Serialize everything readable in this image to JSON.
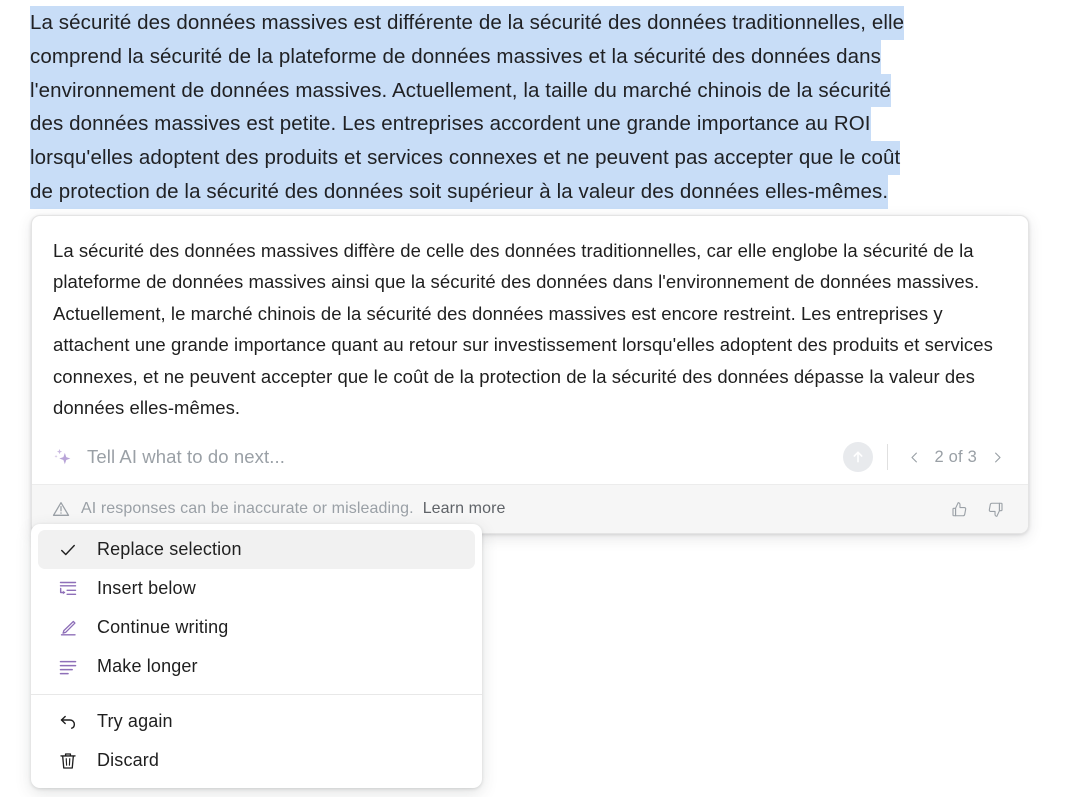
{
  "selection": {
    "name": "highlighted-source-paragraph",
    "highlight_color": "#c8ddf7",
    "lines": [
      "La sécurité des données massives est différente de la sécurité des données traditionnelles, elle",
      "comprend la sécurité de la plateforme de données massives et la sécurité des données dans",
      "l'environnement de données massives. Actuellement, la taille du marché chinois de la sécurité",
      "des données massives est petite. Les entreprises accordent une grande importance au ROI",
      "lorsqu'elles adoptent des produits et services connexes et ne peuvent pas accepter que le coût",
      "de protection de la sécurité des données soit supérieur à la valeur des données elles-mêmes."
    ]
  },
  "ai_card": {
    "response_text": "La sécurité des données massives diffère de celle des données traditionnelles, car elle englobe la sécurité de la plateforme de données massives ainsi que la sécurité des données dans l'environnement de données massives. Actuellement, le marché chinois de la sécurité des données massives est encore restreint. Les entreprises y attachent une grande importance quant au retour sur investissement lorsqu'elles adoptent des produits et services connexes, et ne peuvent accepter que le coût de la protection de la sécurité des données dépasse la valeur des données elles-mêmes.",
    "prompt": {
      "icon": "sparkle-icon",
      "value": "",
      "placeholder": "Tell AI what to do next...",
      "accent_color": "#b9a5d8"
    },
    "submit": {
      "icon": "arrow-up-icon",
      "label": "Submit"
    },
    "pager": {
      "prev_icon": "chevron-left-icon",
      "next_icon": "chevron-right-icon",
      "label": "2 of 3",
      "current": 2,
      "total": 3
    },
    "disclaimer": {
      "icon": "warning-triangle-icon",
      "text": "AI responses can be inaccurate or misleading.",
      "learn_more": "Learn more"
    },
    "feedback": {
      "thumbs_up_icon": "thumbs-up-icon",
      "thumbs_down_icon": "thumbs-down-icon"
    }
  },
  "menu": {
    "items": [
      {
        "label": "Replace selection",
        "icon": "check-icon",
        "selected": true,
        "icon_color": "#1f1f1f"
      },
      {
        "label": "Insert below",
        "icon": "insert-below-icon",
        "selected": false,
        "icon_color": "#8e6fb8"
      },
      {
        "label": "Continue writing",
        "icon": "pencil-icon",
        "selected": false,
        "icon_color": "#8e6fb8"
      },
      {
        "label": "Make longer",
        "icon": "text-lines-icon",
        "selected": false,
        "icon_color": "#8e6fb8"
      }
    ],
    "items_secondary": [
      {
        "label": "Try again",
        "icon": "undo-arrow-icon",
        "icon_color": "#1f1f1f"
      },
      {
        "label": "Discard",
        "icon": "trash-icon",
        "icon_color": "#1f1f1f"
      }
    ]
  }
}
